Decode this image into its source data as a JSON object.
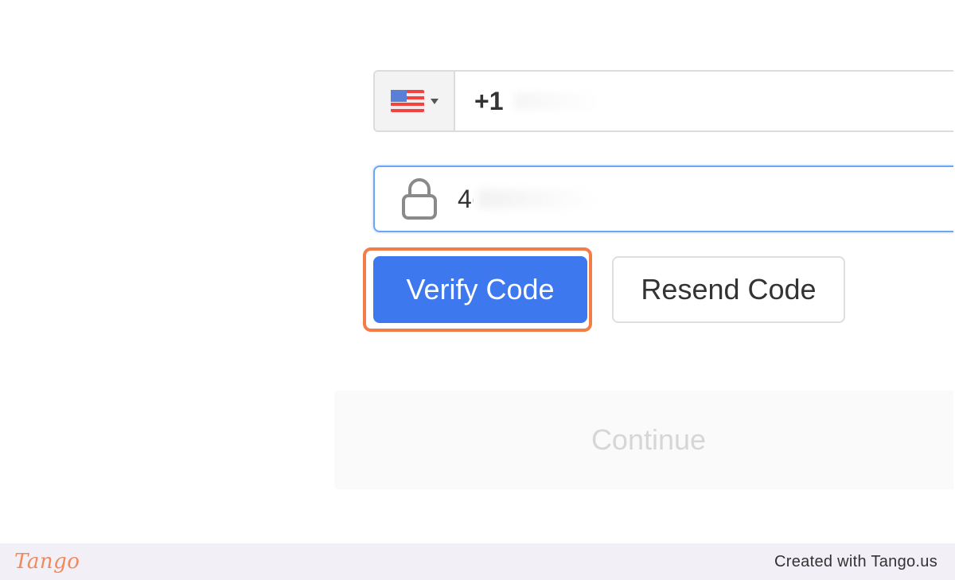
{
  "phone": {
    "country_icon": "us-flag-icon",
    "code": "+1"
  },
  "verification": {
    "value": "4(",
    "icon": "lock-icon"
  },
  "buttons": {
    "verify_label": "Verify Code",
    "resend_label": "Resend Code",
    "continue_label": "Continue"
  },
  "footer": {
    "brand": "Tango",
    "credit": "Created with Tango.us"
  },
  "colors": {
    "primary": "#3d78ee",
    "highlight": "#f47c48",
    "focus": "#6aa6f8"
  }
}
